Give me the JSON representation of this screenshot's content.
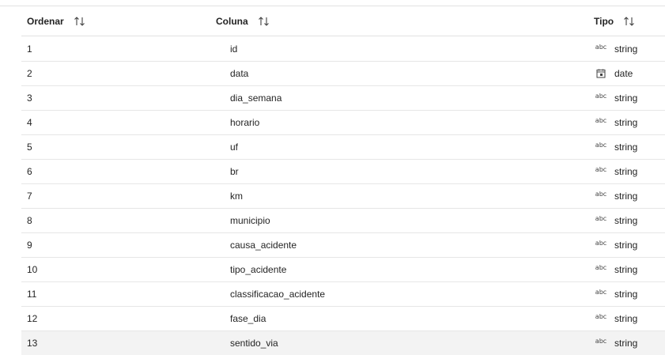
{
  "header": {
    "order_label": "Ordenar",
    "column_label": "Coluna",
    "type_label": "Tipo"
  },
  "icons": {
    "sort": "sort-arrows-icon",
    "string": "abc-icon",
    "date": "calendar-icon"
  },
  "rows": [
    {
      "order": "1",
      "column": "id",
      "type": "string",
      "type_icon": "abc"
    },
    {
      "order": "2",
      "column": "data",
      "type": "date",
      "type_icon": "calendar"
    },
    {
      "order": "3",
      "column": "dia_semana",
      "type": "string",
      "type_icon": "abc"
    },
    {
      "order": "4",
      "column": "horario",
      "type": "string",
      "type_icon": "abc"
    },
    {
      "order": "5",
      "column": "uf",
      "type": "string",
      "type_icon": "abc"
    },
    {
      "order": "6",
      "column": "br",
      "type": "string",
      "type_icon": "abc"
    },
    {
      "order": "7",
      "column": "km",
      "type": "string",
      "type_icon": "abc"
    },
    {
      "order": "8",
      "column": "municipio",
      "type": "string",
      "type_icon": "abc"
    },
    {
      "order": "9",
      "column": "causa_acidente",
      "type": "string",
      "type_icon": "abc"
    },
    {
      "order": "10",
      "column": "tipo_acidente",
      "type": "string",
      "type_icon": "abc"
    },
    {
      "order": "11",
      "column": "classificacao_acidente",
      "type": "string",
      "type_icon": "abc"
    },
    {
      "order": "12",
      "column": "fase_dia",
      "type": "string",
      "type_icon": "abc"
    },
    {
      "order": "13",
      "column": "sentido_via",
      "type": "string",
      "type_icon": "abc"
    }
  ],
  "colors": {
    "hover_row": "#f3f3f3",
    "divider": "#e1e1e1"
  }
}
